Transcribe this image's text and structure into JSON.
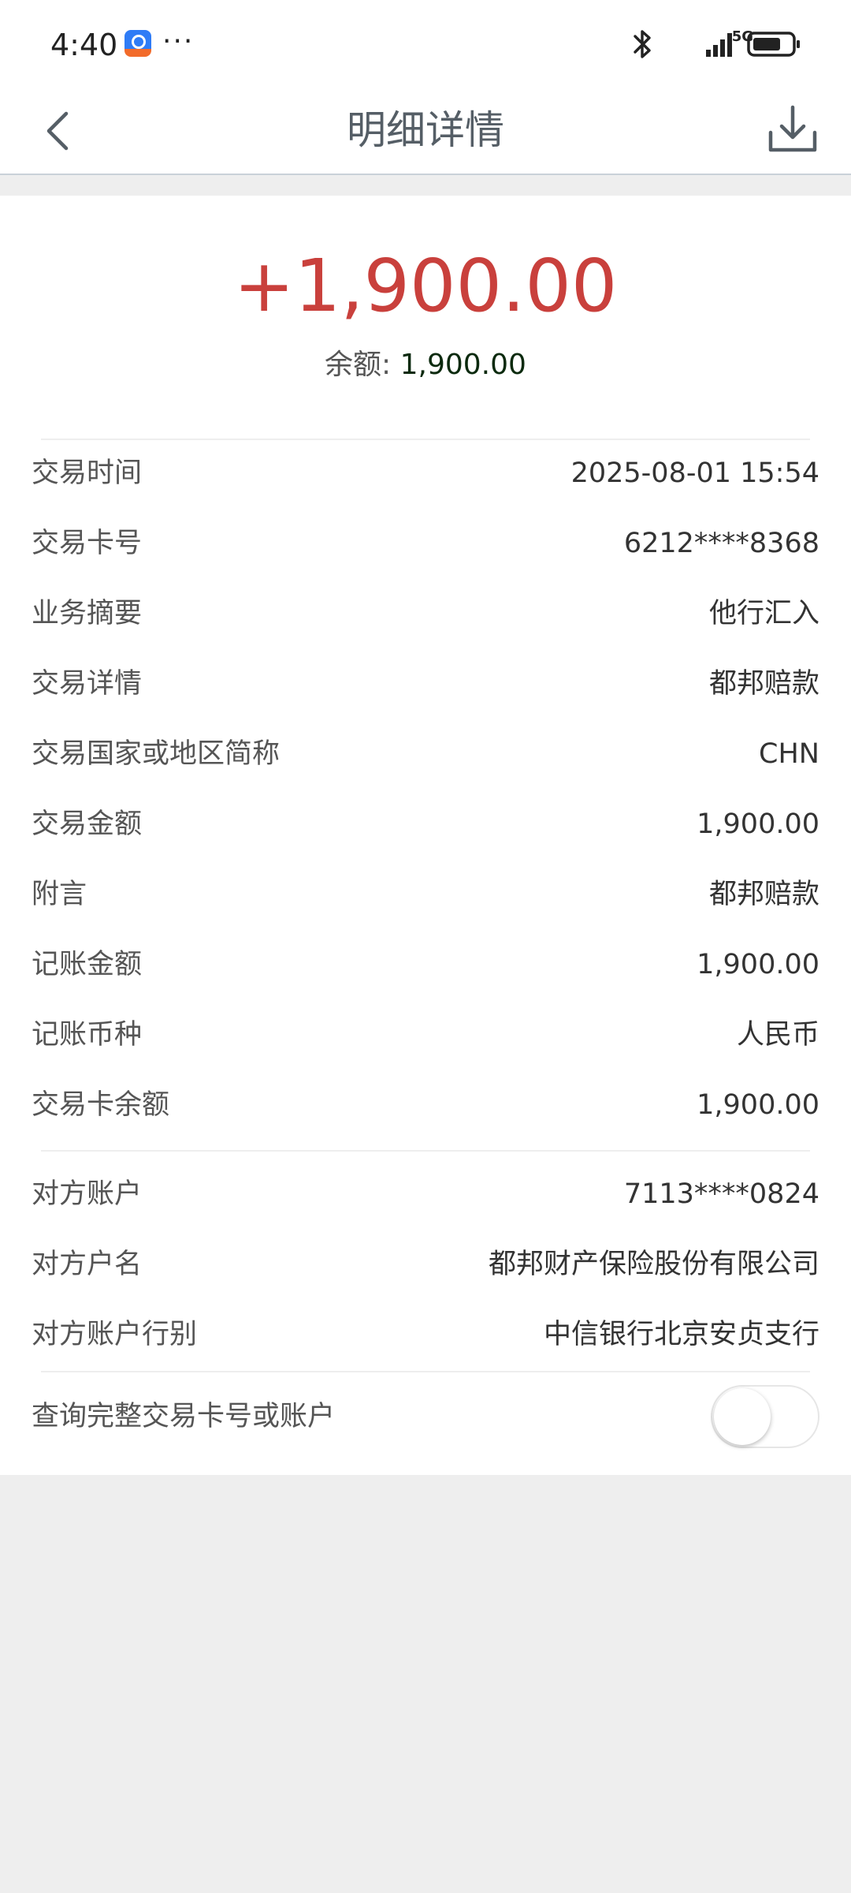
{
  "status_bar": {
    "time": "4:40",
    "notification_icon": "app-notification-icon",
    "more": "···",
    "network": "5G",
    "icons": [
      "bluetooth-icon",
      "signal-icon",
      "battery-icon"
    ]
  },
  "header": {
    "title": "明细详情",
    "back_icon": "chevron-left-icon",
    "download_icon": "download-icon"
  },
  "summary": {
    "amount": "+1,900.00",
    "balance_label": "余额: ",
    "balance_value": "1,900.00"
  },
  "details": [
    {
      "label": "交易时间",
      "value": "2025-08-01 15:54"
    },
    {
      "label": "交易卡号",
      "value": "6212****8368"
    },
    {
      "label": "业务摘要",
      "value": "他行汇入"
    },
    {
      "label": "交易详情",
      "value": "都邦赔款"
    },
    {
      "label": "交易国家或地区简称",
      "value": "CHN"
    },
    {
      "label": "交易金额",
      "value": "1,900.00"
    },
    {
      "label": "附言",
      "value": "都邦赔款"
    },
    {
      "label": "记账金额",
      "value": "1,900.00"
    },
    {
      "label": "记账币种",
      "value": "人民币"
    },
    {
      "label": "交易卡余额",
      "value": "1,900.00"
    }
  ],
  "counterparty": [
    {
      "label": "对方账户",
      "value": "7113****0824"
    },
    {
      "label": "对方户名",
      "value": "都邦财产保险股份有限公司"
    },
    {
      "label": "对方账户行别",
      "value": "中信银行北京安贞支行"
    }
  ],
  "toggle": {
    "label": "查询完整交易卡号或账户",
    "state": "off"
  },
  "colors": {
    "amount": "#c9403c",
    "balance_value": "#0b2a0e",
    "title": "#555e66",
    "page_background": "#eeeeee"
  }
}
